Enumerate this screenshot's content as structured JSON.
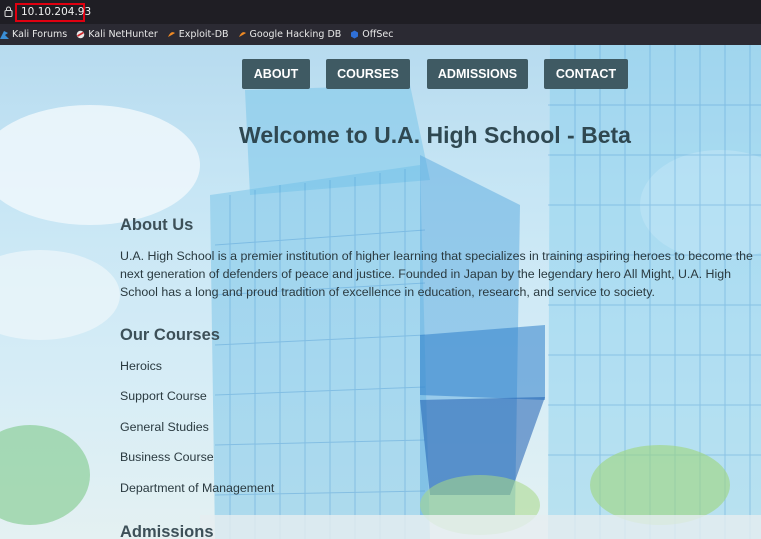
{
  "browser": {
    "url": "10.10.204.93",
    "bookmarks": [
      {
        "label": "Kali Forums",
        "icon": "kali-dragon-icon"
      },
      {
        "label": "Kali NetHunter",
        "icon": "nethunter-icon"
      },
      {
        "label": "Exploit-DB",
        "icon": "exploit-db-icon"
      },
      {
        "label": "Google Hacking DB",
        "icon": "ghdb-icon"
      },
      {
        "label": "OffSec",
        "icon": "offsec-icon"
      }
    ],
    "url_highlight_color": "#e00010"
  },
  "nav": {
    "items": [
      {
        "label": "ABOUT"
      },
      {
        "label": "COURSES"
      },
      {
        "label": "ADMISSIONS"
      },
      {
        "label": "CONTACT"
      }
    ],
    "button_color": "#3f5a63"
  },
  "main": {
    "title": "Welcome to U.A. High School - Beta",
    "about": {
      "heading": "About Us",
      "text": "U.A. High School is a premier institution of higher learning that specializes in training aspiring heroes to become the next generation of defenders of peace and justice. Founded in Japan by the legendary hero All Might, U.A. High School has a long and proud tradition of excellence in education, research, and service to society."
    },
    "courses": {
      "heading": "Our Courses",
      "items": [
        "Heroics",
        "Support Course",
        "General Studies",
        "Business Course",
        "Department of Management"
      ]
    },
    "admissions": {
      "heading": "Admissions"
    }
  }
}
